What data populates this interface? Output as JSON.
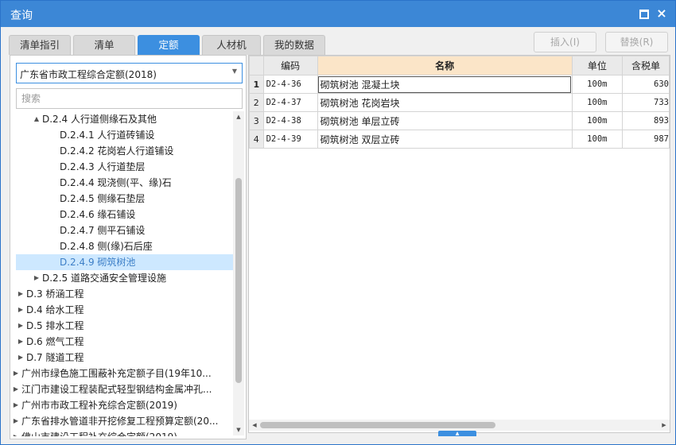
{
  "window": {
    "title": "查询",
    "maximize_icon": "maximize-icon",
    "close_label": "×"
  },
  "tabs": [
    {
      "label": "清单指引",
      "active": false
    },
    {
      "label": "清单",
      "active": false
    },
    {
      "label": "定额",
      "active": true
    },
    {
      "label": "人材机",
      "active": false
    },
    {
      "label": "我的数据",
      "active": false
    }
  ],
  "actions": {
    "insert_label": "插入(I)",
    "replace_label": "替换(R)"
  },
  "left": {
    "selected_library": "广东省市政工程综合定额(2018)",
    "search_placeholder": "搜索",
    "tree": [
      {
        "label": "D.2.4 人行道侧缘石及其他",
        "arrow": "▲",
        "level": 2
      },
      {
        "label": "D.2.4.1 人行道砖铺设",
        "arrow": "",
        "level": 3
      },
      {
        "label": "D.2.4.2 花岗岩人行道铺设",
        "arrow": "",
        "level": 3
      },
      {
        "label": "D.2.4.3 人行道垫层",
        "arrow": "",
        "level": 3
      },
      {
        "label": "D.2.4.4 现浇侧(平、缘)石",
        "arrow": "",
        "level": 3
      },
      {
        "label": "D.2.4.5 侧缘石垫层",
        "arrow": "",
        "level": 3
      },
      {
        "label": "D.2.4.6 缘石铺设",
        "arrow": "",
        "level": 3
      },
      {
        "label": "D.2.4.7 侧平石铺设",
        "arrow": "",
        "level": 3
      },
      {
        "label": "D.2.4.8 侧(缘)石后座",
        "arrow": "",
        "level": 3
      },
      {
        "label": "D.2.4.9 砌筑树池",
        "arrow": "",
        "level": 3,
        "selected": true
      },
      {
        "label": "D.2.5 道路交通安全管理设施",
        "arrow": "▶",
        "level": 2
      },
      {
        "label": "D.3 桥涵工程",
        "arrow": "▶",
        "level": 1
      },
      {
        "label": "D.4 给水工程",
        "arrow": "▶",
        "level": 1
      },
      {
        "label": "D.5 排水工程",
        "arrow": "▶",
        "level": 1
      },
      {
        "label": "D.6 燃气工程",
        "arrow": "▶",
        "level": 1
      },
      {
        "label": "D.7 隧道工程",
        "arrow": "▶",
        "level": 1
      },
      {
        "label": "广州市绿色施工围蔽补充定额子目(19年10...",
        "arrow": "▶",
        "level": 0
      },
      {
        "label": "江门市建设工程装配式轻型钢结构金属冲孔...",
        "arrow": "▶",
        "level": 0
      },
      {
        "label": "广州市市政工程补充综合定额(2019)",
        "arrow": "▶",
        "level": 0
      },
      {
        "label": "广东省排水管道非开挖修复工程预算定额(20...",
        "arrow": "▶",
        "level": 0
      },
      {
        "label": "佛山市建设工程补充综合定额(2019)",
        "arrow": "▶",
        "level": 0
      }
    ]
  },
  "table": {
    "headers": {
      "code": "编码",
      "name": "名称",
      "unit": "单位",
      "price": "含税单"
    },
    "rows": [
      {
        "idx": "1",
        "code": "D2-4-36",
        "name": "砌筑树池 混凝土块",
        "unit": "100m",
        "price": "630"
      },
      {
        "idx": "2",
        "code": "D2-4-37",
        "name": "砌筑树池 花岗岩块",
        "unit": "100m",
        "price": "733"
      },
      {
        "idx": "3",
        "code": "D2-4-38",
        "name": "砌筑树池 单层立砖",
        "unit": "100m",
        "price": "893"
      },
      {
        "idx": "4",
        "code": "D2-4-39",
        "name": "砌筑树池 双层立砖",
        "unit": "100m",
        "price": "987"
      }
    ]
  },
  "colors": {
    "accent": "#3c8fe0",
    "titlebar": "#3c87d6",
    "selected_row": "#cde8ff",
    "name_header": "#fbe5c8"
  }
}
